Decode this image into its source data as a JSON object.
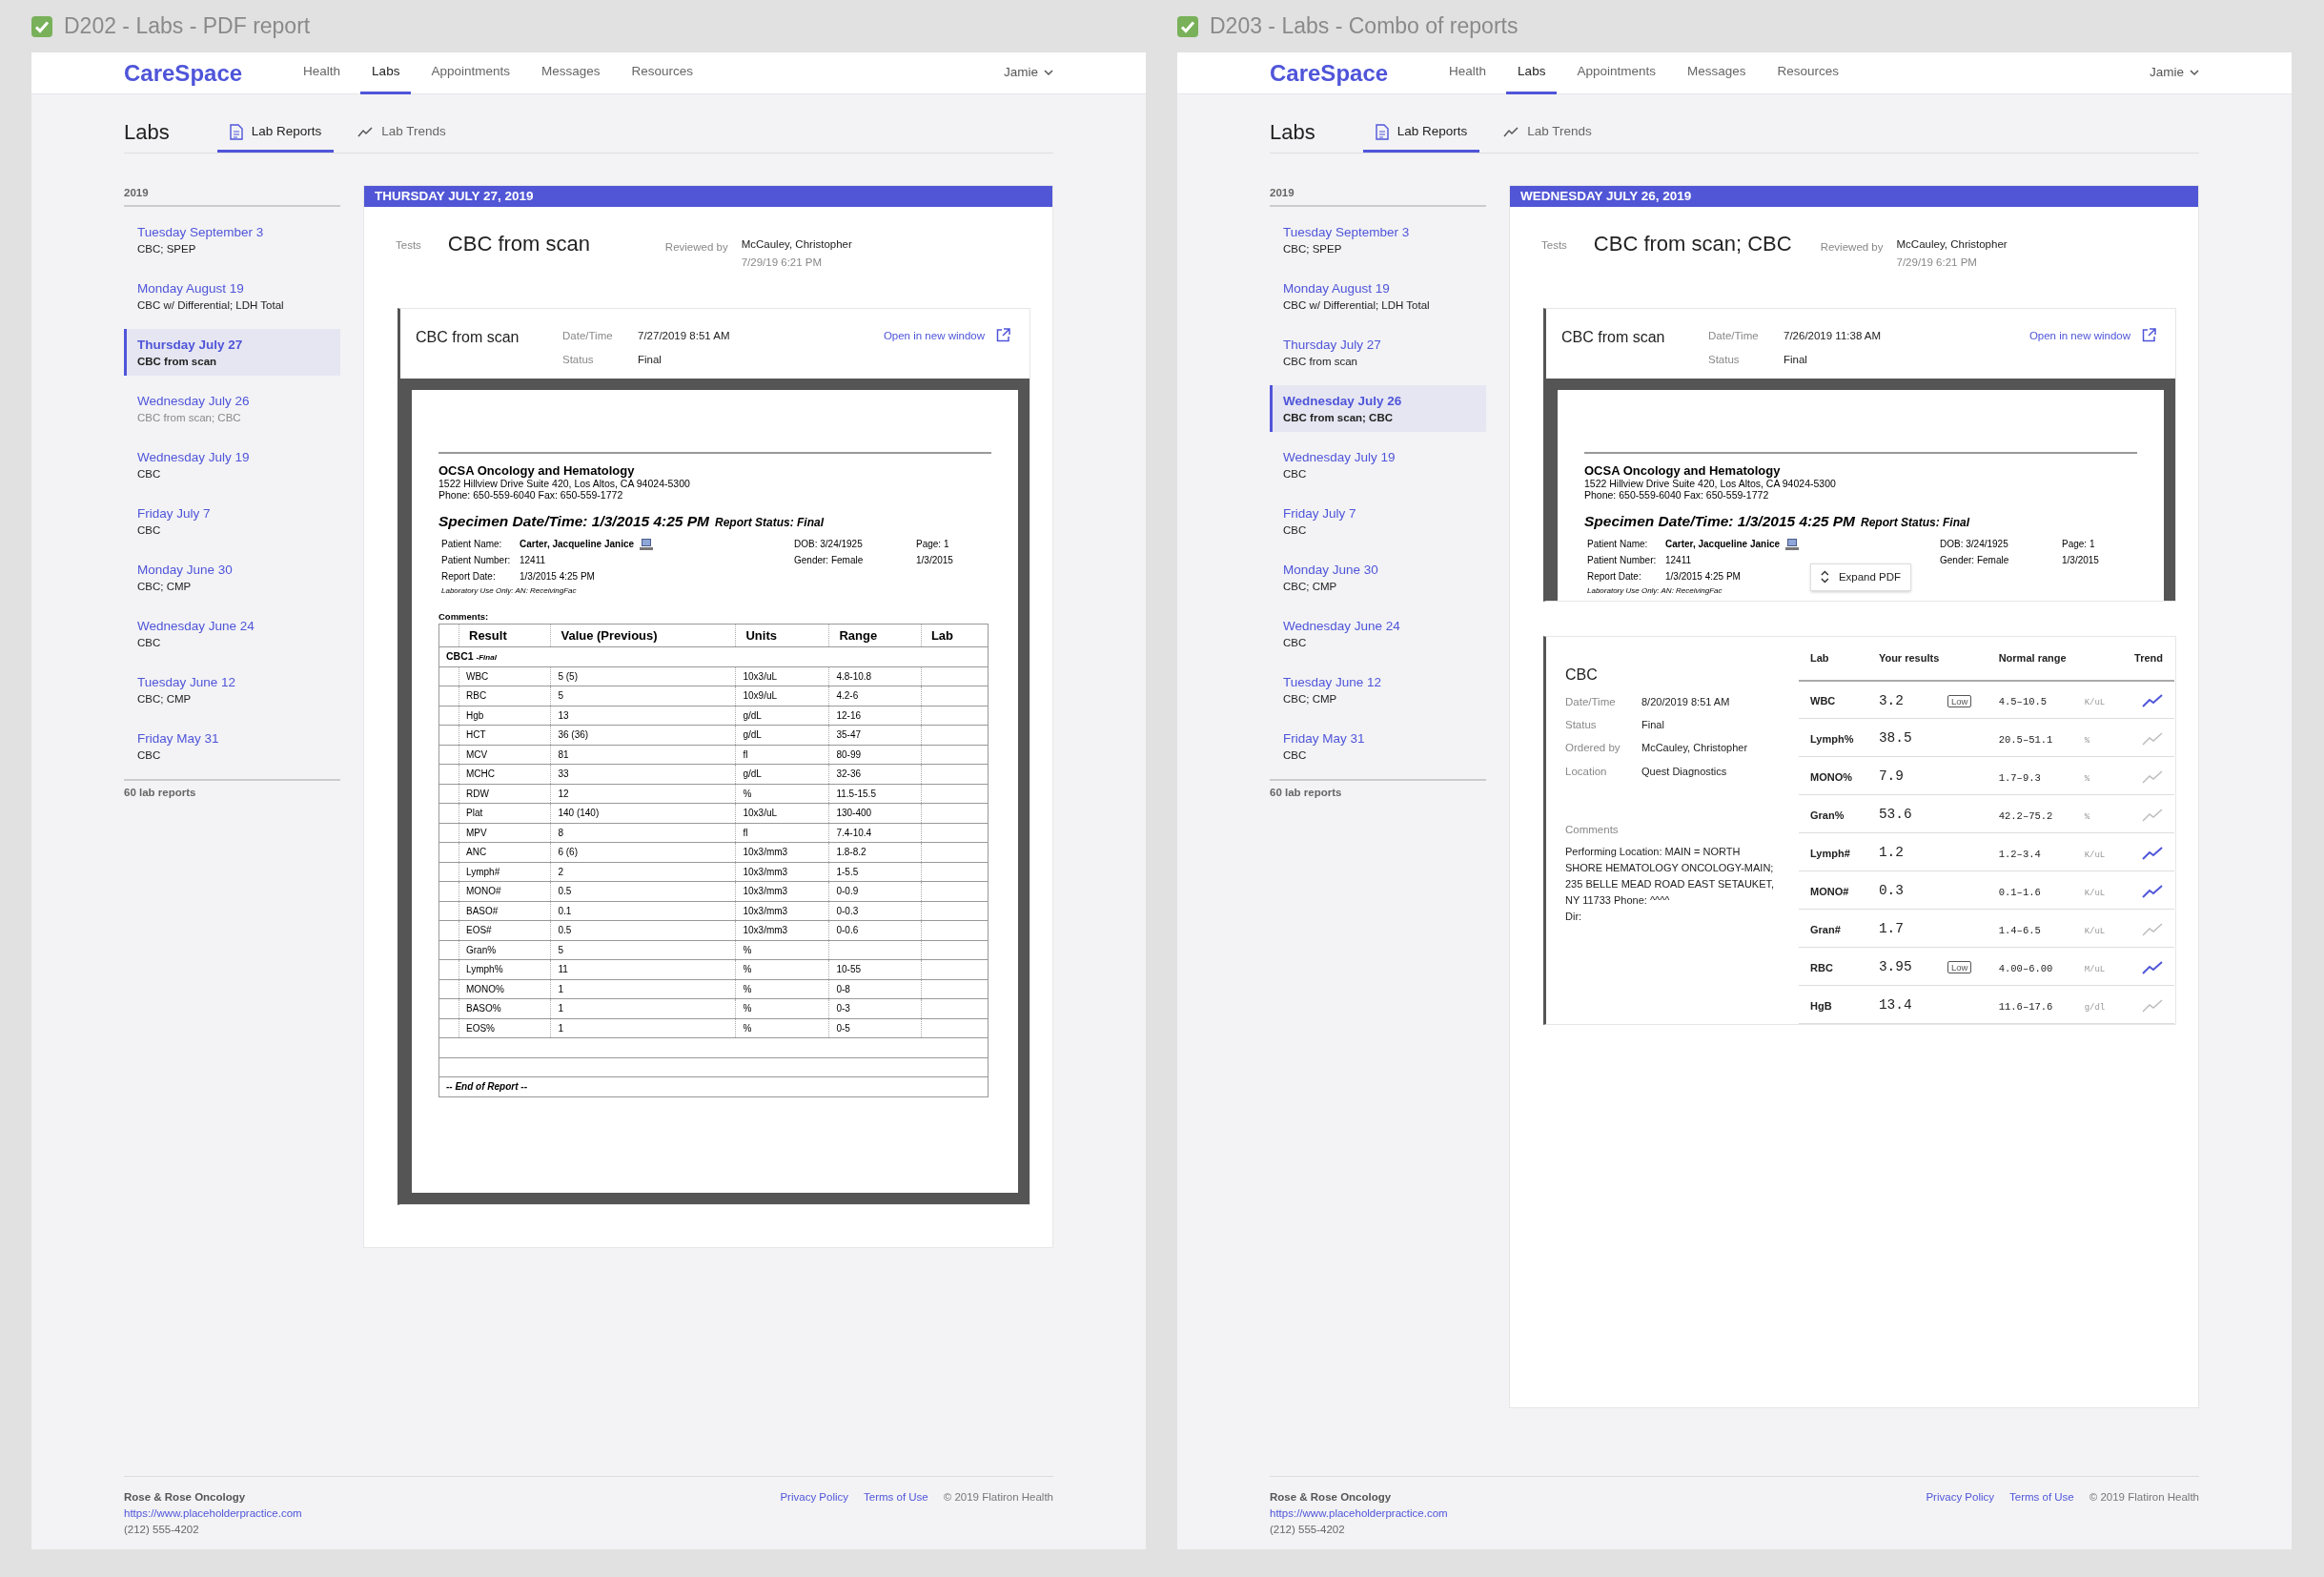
{
  "artboards": [
    {
      "title": "D202 - Labs - PDF report",
      "brand": "CareSpace",
      "nav": [
        {
          "label": "Health",
          "selected": false
        },
        {
          "label": "Labs",
          "selected": true
        },
        {
          "label": "Appointments",
          "selected": false
        },
        {
          "label": "Messages",
          "selected": false
        },
        {
          "label": "Resources",
          "selected": false
        }
      ],
      "user": "Jamie",
      "page_title": "Labs",
      "subtabs": [
        {
          "kind": "reports",
          "label": "Lab Reports",
          "selected": true
        },
        {
          "kind": "trends",
          "label": "Lab Trends",
          "selected": false
        }
      ],
      "sidebar": {
        "year": "2019",
        "count": "60 lab reports",
        "items": [
          {
            "date": "Tuesday September 3",
            "tests": "CBC; SPEP",
            "selected": false,
            "dimmed": false
          },
          {
            "date": "Monday August 19",
            "tests": "CBC w/ Differential; LDH Total",
            "selected": false,
            "dimmed": false
          },
          {
            "date": "Thursday July 27",
            "tests": "CBC from scan",
            "selected": true,
            "dimmed": false
          },
          {
            "date": "Wednesday July 26",
            "tests": "CBC from scan; CBC",
            "selected": false,
            "dimmed": true
          },
          {
            "date": "Wednesday July 19",
            "tests": "CBC",
            "selected": false,
            "dimmed": false
          },
          {
            "date": "Friday July 7",
            "tests": "CBC",
            "selected": false,
            "dimmed": false
          },
          {
            "date": "Monday June 30",
            "tests": "CBC; CMP",
            "selected": false,
            "dimmed": false
          },
          {
            "date": "Wednesday June 24",
            "tests": "CBC",
            "selected": false,
            "dimmed": false
          },
          {
            "date": "Tuesday June 12",
            "tests": "CBC; CMP",
            "selected": false,
            "dimmed": false
          },
          {
            "date": "Friday May 31",
            "tests": "CBC",
            "selected": false,
            "dimmed": false
          }
        ]
      },
      "report": {
        "banner": "THURSDAY JULY 27, 2019",
        "tests_label": "Tests",
        "tests": "CBC from scan",
        "reviewed_label": "Reviewed by",
        "reviewer": "McCauley, Christopher",
        "reviewed_at": "7/29/19 6:21 PM",
        "documents": [
          {
            "kind": "pdf",
            "name": "CBC from scan",
            "fields": [
              {
                "label": "Date/Time",
                "value": "7/27/2019 8:51 AM"
              },
              {
                "label": "Status",
                "value": "Final"
              }
            ],
            "link": "Open in new window",
            "expanded": true,
            "pdf": {
              "org": "OCSA Oncology and Hematology",
              "address": "1522 Hillview Drive Suite 420, Los Altos, CA 94024-5300",
              "phone": "Phone: 650-559-6040 Fax: 650-559-1772",
              "specimen": "Specimen Date/Time: 1/3/2015 4:25 PM",
              "report_status": "Report Status: Final",
              "patient": [
                {
                  "label": "Patient Name:",
                  "value": "Carter, Jacqueline Janice",
                  "bold": true
                },
                {
                  "label": "Patient Number:",
                  "value": "12411",
                  "bold": false
                },
                {
                  "label": "Report Date:",
                  "value": "1/3/2015 4:25 PM",
                  "bold": false
                }
              ],
              "info_middle": [
                "DOB: 3/24/1925",
                "Gender: Female"
              ],
              "info_right": [
                "Page: 1",
                "1/3/2015"
              ],
              "lab_use": "Laboratory Use Only: AN: ReceivingFac",
              "comments_label": "Comments:",
              "columns": [
                "Result",
                "Value (Previous)",
                "Units",
                "Range",
                "Lab"
              ],
              "group": "CBC1",
              "group_status": "-Final",
              "rows": [
                [
                  "WBC",
                  "5  (5)",
                  "10x3/uL",
                  "4.8-10.8"
                ],
                [
                  "RBC",
                  "5",
                  "10x9/uL",
                  "4.2-6"
                ],
                [
                  "Hgb",
                  "13",
                  "g/dL",
                  "12-16"
                ],
                [
                  "HCT",
                  "36  (36)",
                  "g/dL",
                  "35-47"
                ],
                [
                  "MCV",
                  "81",
                  "fl",
                  "80-99"
                ],
                [
                  "MCHC",
                  "33",
                  "g/dL",
                  "32-36"
                ],
                [
                  "RDW",
                  "12",
                  "%",
                  "11.5-15.5"
                ],
                [
                  "Plat",
                  "140  (140)",
                  "10x3/uL",
                  "130-400"
                ],
                [
                  "MPV",
                  "8",
                  "fl",
                  "7.4-10.4"
                ],
                [
                  "ANC",
                  "6  (6)",
                  "10x3/mm3",
                  "1.8-8.2"
                ],
                [
                  "Lymph#",
                  "2",
                  "10x3/mm3",
                  "1-5.5"
                ],
                [
                  "MONO#",
                  "0.5",
                  "10x3/mm3",
                  "0-0.9"
                ],
                [
                  "BASO#",
                  "0.1",
                  "10x3/mm3",
                  "0-0.3"
                ],
                [
                  "EOS#",
                  "0.5",
                  "10x3/mm3",
                  "0-0.6"
                ],
                [
                  "Gran%",
                  "5",
                  "%",
                  ""
                ],
                [
                  "Lymph%",
                  "11",
                  "%",
                  "10-55"
                ],
                [
                  "MONO%",
                  "1",
                  "%",
                  "0-8"
                ],
                [
                  "BASO%",
                  "1",
                  "%",
                  "0-3"
                ],
                [
                  "EOS%",
                  "1",
                  "%",
                  "0-5"
                ]
              ],
              "end": "-- End of Report --"
            }
          }
        ]
      },
      "footer": {
        "practice": "Rose & Rose Oncology",
        "url": "https://www.placeholderpractice.com",
        "phone": "(212) 555-4202",
        "links": [
          "Privacy Policy",
          "Terms of Use"
        ],
        "copyright": "© 2019 Flatiron Health"
      }
    },
    {
      "title": "D203 - Labs - Combo of reports",
      "brand": "CareSpace",
      "nav": [
        {
          "label": "Health",
          "selected": false
        },
        {
          "label": "Labs",
          "selected": true
        },
        {
          "label": "Appointments",
          "selected": false
        },
        {
          "label": "Messages",
          "selected": false
        },
        {
          "label": "Resources",
          "selected": false
        }
      ],
      "user": "Jamie",
      "page_title": "Labs",
      "subtabs": [
        {
          "kind": "reports",
          "label": "Lab Reports",
          "selected": true
        },
        {
          "kind": "trends",
          "label": "Lab Trends",
          "selected": false
        }
      ],
      "sidebar": {
        "year": "2019",
        "count": "60 lab reports",
        "items": [
          {
            "date": "Tuesday September 3",
            "tests": "CBC; SPEP",
            "selected": false,
            "dimmed": false
          },
          {
            "date": "Monday August 19",
            "tests": "CBC w/ Differential; LDH Total",
            "selected": false,
            "dimmed": false
          },
          {
            "date": "Thursday July 27",
            "tests": "CBC from scan",
            "selected": false,
            "dimmed": false
          },
          {
            "date": "Wednesday July 26",
            "tests": "CBC from scan; CBC",
            "selected": true,
            "dimmed": false
          },
          {
            "date": "Wednesday July 19",
            "tests": "CBC",
            "selected": false,
            "dimmed": false
          },
          {
            "date": "Friday July 7",
            "tests": "CBC",
            "selected": false,
            "dimmed": false
          },
          {
            "date": "Monday June 30",
            "tests": "CBC; CMP",
            "selected": false,
            "dimmed": false
          },
          {
            "date": "Wednesday June 24",
            "tests": "CBC",
            "selected": false,
            "dimmed": false
          },
          {
            "date": "Tuesday June 12",
            "tests": "CBC; CMP",
            "selected": false,
            "dimmed": false
          },
          {
            "date": "Friday May 31",
            "tests": "CBC",
            "selected": false,
            "dimmed": false
          }
        ]
      },
      "report": {
        "banner": "WEDNESDAY JULY 26, 2019",
        "tests_label": "Tests",
        "tests": "CBC from scan; CBC",
        "reviewed_label": "Reviewed by",
        "reviewer": "McCauley, Christopher",
        "reviewed_at": "7/29/19 6:21 PM",
        "documents": [
          {
            "kind": "pdf",
            "name": "CBC from scan",
            "fields": [
              {
                "label": "Date/Time",
                "value": "7/26/2019 11:38 AM"
              },
              {
                "label": "Status",
                "value": "Final"
              }
            ],
            "link": "Open in new window",
            "expanded": false,
            "expand_label": "Expand PDF",
            "pdf": {
              "org": "OCSA Oncology and Hematology",
              "address": "1522 Hillview Drive Suite 420, Los Altos, CA 94024-5300",
              "phone": "Phone: 650-559-6040 Fax: 650-559-1772",
              "specimen": "Specimen Date/Time: 1/3/2015 4:25 PM",
              "report_status": "Report Status: Final",
              "patient": [
                {
                  "label": "Patient Name:",
                  "value": "Carter, Jacqueline Janice",
                  "bold": true
                },
                {
                  "label": "Patient Number:",
                  "value": "12411",
                  "bold": false
                },
                {
                  "label": "Report Date:",
                  "value": "1/3/2015 4:25 PM",
                  "bold": false
                }
              ],
              "info_middle": [
                "DOB: 3/24/1925",
                "Gender: Female"
              ],
              "info_right": [
                "Page: 1",
                "1/3/2015"
              ],
              "lab_use": "Laboratory Use Only: AN: ReceivingFac"
            }
          },
          {
            "kind": "results",
            "name": "CBC",
            "fields": [
              {
                "label": "Date/Time",
                "value": "8/20/2019 8:51 AM"
              },
              {
                "label": "Status",
                "value": "Final"
              },
              {
                "label": "Ordered by",
                "value": "McCauley, Christopher"
              },
              {
                "label": "Location",
                "value": "Quest Diagnostics"
              }
            ],
            "comments_label": "Comments",
            "comments": "Performing Location: MAIN = NORTH SHORE HEMATOLOGY ONCOLOGY-MAIN; 235 BELLE MEAD ROAD EAST SETAUKET, NY 11733 Phone: ^^^^\nDir:",
            "columns": [
              "Lab",
              "Your results",
              "Normal range",
              "Trend"
            ],
            "rows": [
              {
                "lab": "WBC",
                "result": "3.2",
                "flag": "Low",
                "range": "4.5–10.5",
                "units": "K/uL",
                "trend_highlighted": true
              },
              {
                "lab": "Lymph%",
                "result": "38.5",
                "range": "20.5–51.1",
                "units": "%",
                "trend_highlighted": false
              },
              {
                "lab": "MONO%",
                "result": "7.9",
                "range": "1.7–9.3",
                "units": "%",
                "trend_highlighted": false
              },
              {
                "lab": "Gran%",
                "result": "53.6",
                "range": "42.2–75.2",
                "units": "%",
                "trend_highlighted": false
              },
              {
                "lab": "Lymph#",
                "result": "1.2",
                "range": "1.2–3.4",
                "units": "K/uL",
                "trend_highlighted": true
              },
              {
                "lab": "MONO#",
                "result": "0.3",
                "range": "0.1–1.6",
                "units": "K/uL",
                "trend_highlighted": true
              },
              {
                "lab": "Gran#",
                "result": "1.7",
                "range": "1.4–6.5",
                "units": "K/uL",
                "trend_highlighted": false
              },
              {
                "lab": "RBC",
                "result": "3.95",
                "flag": "Low",
                "range": "4.00–6.00",
                "units": "M/uL",
                "trend_highlighted": true
              },
              {
                "lab": "HgB",
                "result": "13.4",
                "range": "11.6–17.6",
                "units": "g/dl",
                "trend_highlighted": false
              }
            ]
          }
        ]
      },
      "footer": {
        "practice": "Rose & Rose Oncology",
        "url": "https://www.placeholderpractice.com",
        "phone": "(212) 555-4202",
        "links": [
          "Privacy Policy",
          "Terms of Use"
        ],
        "copyright": "© 2019 Flatiron Health"
      }
    }
  ]
}
